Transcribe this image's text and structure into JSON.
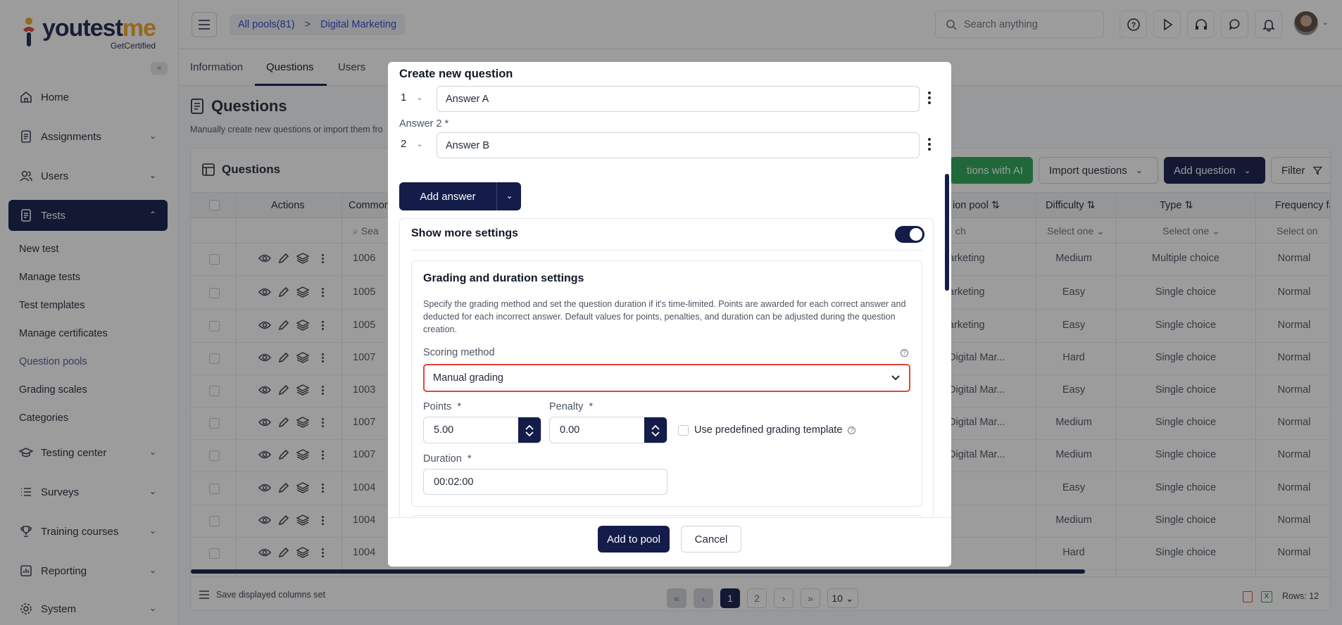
{
  "brand": {
    "name_main": "youtest",
    "name_accent": "me",
    "sub": "GetCertified"
  },
  "sidebar": {
    "items": [
      {
        "label": "Home",
        "icon": "home-icon"
      },
      {
        "label": "Assignments",
        "icon": "document-icon"
      },
      {
        "label": "Users",
        "icon": "users-icon"
      },
      {
        "label": "Tests",
        "icon": "test-icon"
      },
      {
        "label": "Testing center",
        "icon": "graduation-cap-icon"
      },
      {
        "label": "Surveys",
        "icon": "list-icon"
      },
      {
        "label": "Training courses",
        "icon": "trophy-icon"
      },
      {
        "label": "Reporting",
        "icon": "report-icon"
      },
      {
        "label": "System",
        "icon": "gear-icon"
      }
    ],
    "sub_items": [
      "New test",
      "Manage tests",
      "Test templates",
      "Manage certificates",
      "Question pools",
      "Grading scales",
      "Categories"
    ]
  },
  "topbar": {
    "breadcrumb": [
      "All pools(81)",
      ">",
      "Digital Marketing"
    ],
    "search_placeholder": "Search anything"
  },
  "tabs": [
    "Information",
    "Questions",
    "Users"
  ],
  "page": {
    "title": "Questions",
    "desc": "Manually create new questions or import them fro"
  },
  "card": {
    "title": "Questions",
    "btn_ai": "tions with AI",
    "btn_import": "Import questions",
    "btn_add": "Add question",
    "btn_filter": "Filter",
    "headers": {
      "actions": "Actions",
      "common": "Common",
      "pool": "ion pool",
      "difficulty": "Difficulty",
      "type": "Type",
      "frequency": "Frequency fac"
    },
    "filters": {
      "search": "Sea",
      "pool": "ch",
      "difficulty": "Select one",
      "type": "Select one",
      "frequency": "Select on"
    },
    "rows": [
      {
        "id": "1006",
        "pool": "arketing",
        "difficulty": "Medium",
        "type": "Multiple choice",
        "freq": "Normal"
      },
      {
        "id": "1005",
        "pool": "arketing",
        "difficulty": "Easy",
        "type": "Single choice",
        "freq": "Normal"
      },
      {
        "id": "1005",
        "pool": "arketing",
        "difficulty": "Easy",
        "type": "Single choice",
        "freq": "Normal"
      },
      {
        "id": "1007",
        "pool": "Digital Mar...",
        "difficulty": "Hard",
        "type": "Single choice",
        "freq": "Normal"
      },
      {
        "id": "1003",
        "pool": "Digital Mar...",
        "difficulty": "Easy",
        "type": "Single choice",
        "freq": "Normal"
      },
      {
        "id": "1007",
        "pool": "Digital Mar...",
        "difficulty": "Medium",
        "type": "Single choice",
        "freq": "Normal"
      },
      {
        "id": "1007",
        "pool": "Digital Mar...",
        "difficulty": "Medium",
        "type": "Single choice",
        "freq": "Normal"
      },
      {
        "id": "1004",
        "pool": "",
        "difficulty": "Easy",
        "type": "Single choice",
        "freq": "Normal"
      },
      {
        "id": "1004",
        "pool": "",
        "difficulty": "Medium",
        "type": "Single choice",
        "freq": "Normal"
      },
      {
        "id": "1004",
        "pool": "",
        "difficulty": "Hard",
        "type": "Single choice",
        "freq": "Normal"
      }
    ],
    "footer": {
      "save_cols": "Save displayed columns set",
      "page1": "1",
      "page2": "2",
      "per_page": "10",
      "rows": "Rows: 12"
    }
  },
  "modal": {
    "title": "Create new question",
    "answer1": {
      "num": "1",
      "value": "Answer A"
    },
    "answer2_label": "Answer 2 *",
    "answer2": {
      "num": "2",
      "value": "Answer B"
    },
    "add_answer": "Add answer",
    "show_more": "Show more settings",
    "grading_title": "Grading and duration settings",
    "grading_desc": "Specify the grading method and set the question duration if it's time-limited. Points are awarded for each correct answer and deducted for each incorrect answer. Default values for points, penalties, and duration can be adjusted during the question creation.",
    "scoring_label": "Scoring method",
    "scoring_value": "Manual grading",
    "points_label": "Points",
    "points_value": "5.00",
    "penalty_label": "Penalty",
    "penalty_value": "0.00",
    "required_mark": "*",
    "template_label": "Use predefined grading template",
    "duration_label": "Duration",
    "duration_value": "00:02:00",
    "add_to_pool": "Add to pool",
    "cancel": "Cancel"
  }
}
